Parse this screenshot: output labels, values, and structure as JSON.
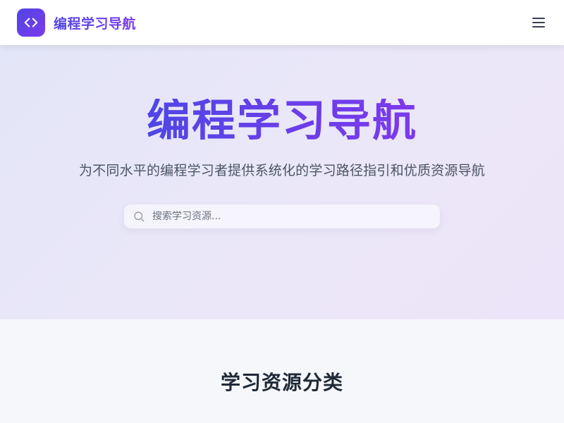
{
  "header": {
    "brand_title": "编程学习导航",
    "logo_icon": "code-brackets-icon",
    "menu_icon": "hamburger-menu-icon"
  },
  "hero": {
    "title": "编程学习导航",
    "subtitle": "为不同水平的编程学习者提供系统化的学习路径指引和优质资源导航"
  },
  "search": {
    "placeholder": "搜索学习资源...",
    "value": "",
    "icon": "search-icon"
  },
  "categories": {
    "title": "学习资源分类"
  },
  "colors": {
    "accent_start": "#4f46e5",
    "accent_end": "#7c3aed",
    "text_dark": "#1f2937",
    "text_muted": "#4b5563"
  }
}
